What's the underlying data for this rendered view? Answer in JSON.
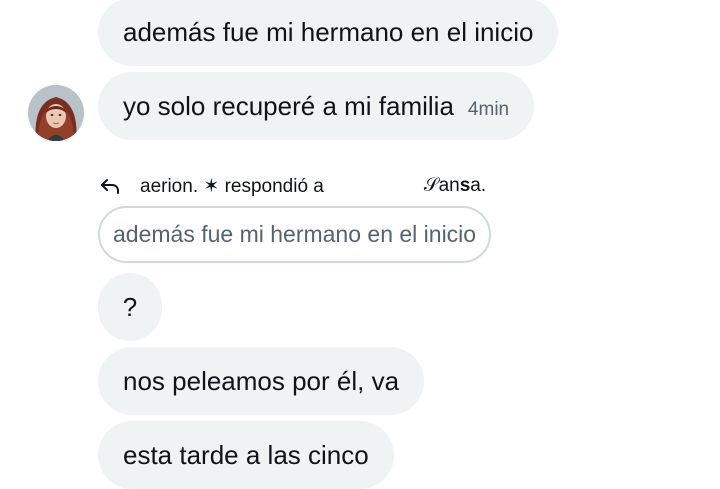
{
  "messages": [
    {
      "text": "además fue mi hermano en el inicio"
    },
    {
      "text": "yo solo recuperé a mi familia",
      "time": "4min"
    },
    {
      "text": "?"
    },
    {
      "text": "nos peleamos por él, va"
    },
    {
      "text": "esta tarde a las cinco"
    }
  ],
  "reply": {
    "header": "aerion. ✶ respondió a",
    "target_prefix": "𝒮an",
    "target_bold": "s",
    "target_suffix": "a.",
    "quoted_text": "además fue mi hermano en el inicio"
  },
  "icons": {
    "reply": "reply-arrow-icon",
    "avatar": "avatar-red-haired-person"
  },
  "colors": {
    "bubble_bg": "#eff3f4",
    "text_primary": "#0f1419",
    "text_secondary": "#536471",
    "quote_border": "#cfd9de"
  }
}
